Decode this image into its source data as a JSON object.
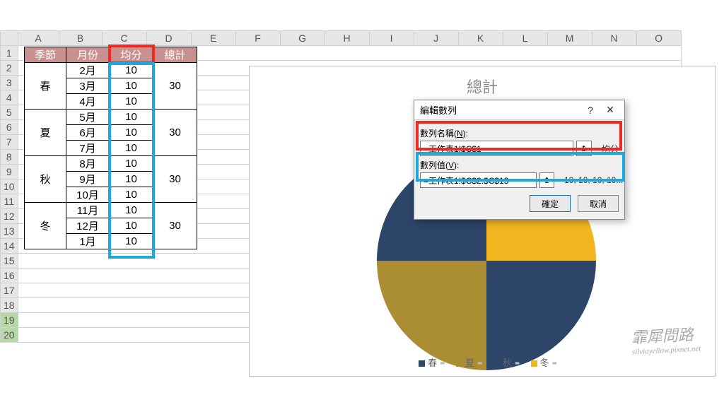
{
  "columns": [
    "A",
    "B",
    "C",
    "D",
    "E",
    "F",
    "G",
    "H",
    "I",
    "J",
    "K",
    "L",
    "M",
    "N",
    "O"
  ],
  "row_labels": [
    "1",
    "2",
    "3",
    "4",
    "5",
    "6",
    "7",
    "8",
    "9",
    "10",
    "11",
    "12",
    "13",
    "14",
    "15",
    "16",
    "17",
    "18",
    "19",
    "20"
  ],
  "selected_rows": [
    19,
    20
  ],
  "table": {
    "headers": [
      "季節",
      "月份",
      "均分",
      "總計"
    ],
    "seasons": [
      {
        "name": "春",
        "months": [
          "2月",
          "3月",
          "4月"
        ],
        "avgs": [
          10,
          10,
          10
        ],
        "total": 30
      },
      {
        "name": "夏",
        "months": [
          "5月",
          "6月",
          "7月"
        ],
        "avgs": [
          10,
          10,
          10
        ],
        "total": 30
      },
      {
        "name": "秋",
        "months": [
          "8月",
          "9月",
          "10月"
        ],
        "avgs": [
          10,
          10,
          10
        ],
        "total": 30
      },
      {
        "name": "冬",
        "months": [
          "11月",
          "12月",
          "1月"
        ],
        "avgs": [
          10,
          10,
          10
        ],
        "total": 30
      }
    ]
  },
  "chart": {
    "title": "總計",
    "legend": [
      "春",
      "夏",
      "秋",
      "冬"
    ],
    "colors": {
      "春": "#2d4569",
      "夏": "#ab8e34",
      "秋": "#2d4569",
      "冬": "#f0b51f"
    }
  },
  "dialog": {
    "title": "編輯數列",
    "help_icon": "?",
    "close_icon": "✕",
    "name_label_pre": "數列名稱(",
    "name_label_u": "N",
    "name_label_post": "):",
    "name_value": "=工作表1!$C$1",
    "name_preview_prefix": "= ",
    "name_preview": "均分",
    "val_label_pre": "數列值(",
    "val_label_u": "V",
    "val_label_post": "):",
    "val_value": "=工作表1!$C$2:$C$13",
    "val_preview_prefix": "= ",
    "val_preview": "10, 10, 10, 10...",
    "ok": "確定",
    "cancel": "取消"
  },
  "watermark": {
    "main": "霏犀問路",
    "sub": "silviayellow.pixnet.net"
  },
  "chart_data": {
    "type": "pie",
    "title": "總計",
    "categories": [
      "2月",
      "3月",
      "4月",
      "5月",
      "6月",
      "7月",
      "8月",
      "9月",
      "10月",
      "11月",
      "12月",
      "1月"
    ],
    "values": [
      10,
      10,
      10,
      10,
      10,
      10,
      10,
      10,
      10,
      10,
      10,
      10
    ],
    "series_name": "均分",
    "legend_groups": [
      "春",
      "夏",
      "秋",
      "冬"
    ]
  }
}
